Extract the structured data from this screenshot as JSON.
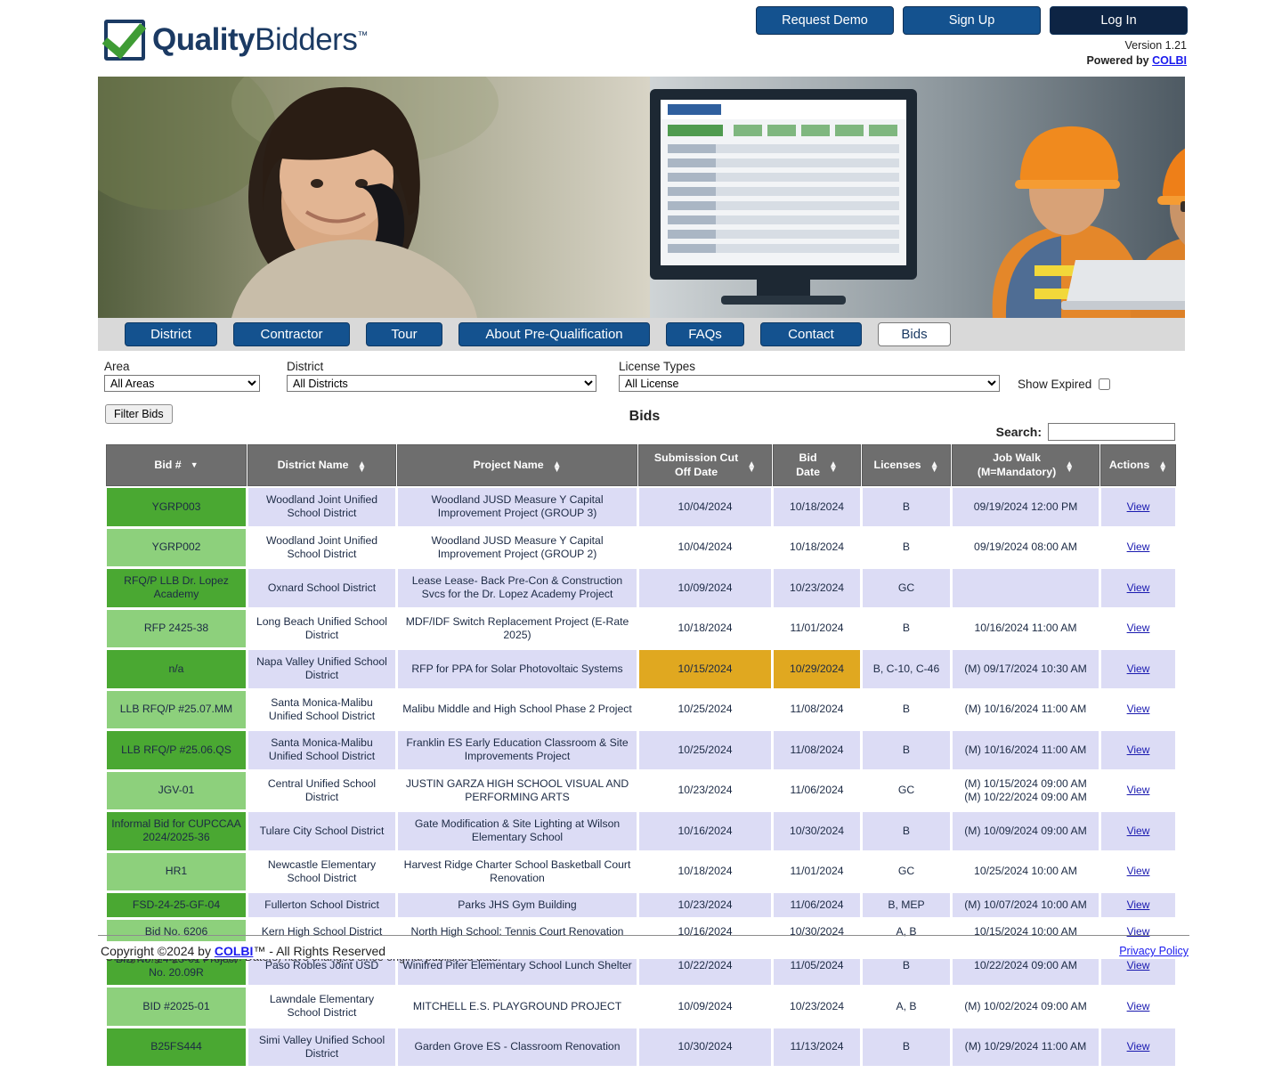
{
  "brand": {
    "name_bold": "Quality",
    "name_light": "Bidders",
    "tm": "™"
  },
  "topbar": {
    "request_demo": "Request Demo",
    "sign_up": "Sign Up",
    "log_in": "Log In",
    "version": "Version 1.21",
    "powered_by": "Powered by ",
    "powered_link": "COLBI"
  },
  "nav": {
    "items": [
      {
        "label": "District",
        "active": false
      },
      {
        "label": "Contractor",
        "active": false
      },
      {
        "label": "Tour",
        "active": false
      },
      {
        "label": "About Pre-Qualification",
        "active": false
      },
      {
        "label": "FAQs",
        "active": false
      },
      {
        "label": "Contact",
        "active": false
      },
      {
        "label": "Bids",
        "active": true
      }
    ]
  },
  "filters": {
    "area_label": "Area",
    "area_value": "All Areas",
    "district_label": "District",
    "district_value": "All Districts",
    "license_label": "License Types",
    "license_value": "All License",
    "show_expired_label": "Show Expired",
    "show_expired_checked": false,
    "filter_button": "Filter Bids"
  },
  "table_section": {
    "title": "Bids",
    "search_label": "Search:",
    "search_value": "",
    "search_placeholder": ""
  },
  "columns": [
    {
      "label": "Bid #",
      "sort": "desc"
    },
    {
      "label": "District Name",
      "sort": "both"
    },
    {
      "label": "Project Name",
      "sort": "both"
    },
    {
      "label": "Submission Cut Off Date",
      "line1": "Submission Cut",
      "line2": "Off Date",
      "sort": "both"
    },
    {
      "label": "Bid Date",
      "line1": "Bid",
      "line2": "Date",
      "sort": "both"
    },
    {
      "label": "Licenses",
      "sort": "both"
    },
    {
      "label": "Job Walk (M=Mandatory)",
      "line1": "Job Walk",
      "line2": "(M=Mandatory)",
      "sort": "both"
    },
    {
      "label": "Actions",
      "sort": "both"
    }
  ],
  "rows": [
    {
      "bid": "YGRP003",
      "district": "Woodland Joint Unified School District",
      "project": "Woodland JUSD Measure Y Capital Improvement Project (GROUP 3)",
      "submission": "10/04/2024",
      "bid_date": "10/18/2024",
      "licenses": "B",
      "job_walk": "09/19/2024 12:00 PM",
      "action": "View",
      "submission_changed": false,
      "bid_date_changed": false
    },
    {
      "bid": "YGRP002",
      "district": "Woodland Joint Unified School District",
      "project": "Woodland JUSD Measure Y Capital Improvement Project (GROUP 2)",
      "submission": "10/04/2024",
      "bid_date": "10/18/2024",
      "licenses": "B",
      "job_walk": "09/19/2024 08:00 AM",
      "action": "View",
      "submission_changed": false,
      "bid_date_changed": false
    },
    {
      "bid": "RFQ/P LLB Dr. Lopez Academy",
      "district": "Oxnard School District",
      "project": "Lease Lease- Back Pre-Con & Construction Svcs for the Dr. Lopez Academy Project",
      "submission": "10/09/2024",
      "bid_date": "10/23/2024",
      "licenses": "GC",
      "job_walk": "",
      "action": "View",
      "submission_changed": false,
      "bid_date_changed": false
    },
    {
      "bid": "RFP 2425-38",
      "district": "Long Beach Unified School District",
      "project": "MDF/IDF Switch Replacement Project (E-Rate 2025)",
      "submission": "10/18/2024",
      "bid_date": "11/01/2024",
      "licenses": "B",
      "job_walk": "10/16/2024 11:00 AM",
      "action": "View",
      "submission_changed": false,
      "bid_date_changed": false
    },
    {
      "bid": "n/a",
      "district": "Napa Valley Unified School District",
      "project": "RFP for PPA for Solar Photovoltaic Systems",
      "submission": "10/15/2024",
      "bid_date": "10/29/2024",
      "licenses": "B, C-10, C-46",
      "job_walk": "(M) 09/17/2024 10:30 AM",
      "action": "View",
      "submission_changed": true,
      "bid_date_changed": true
    },
    {
      "bid": "LLB RFQ/P #25.07.MM",
      "district": "Santa Monica-Malibu Unified School District",
      "project": "Malibu Middle and High School Phase 2 Project",
      "submission": "10/25/2024",
      "bid_date": "11/08/2024",
      "licenses": "B",
      "job_walk": "(M) 10/16/2024 11:00 AM",
      "action": "View",
      "submission_changed": false,
      "bid_date_changed": false
    },
    {
      "bid": "LLB RFQ/P #25.06.QS",
      "district": "Santa Monica-Malibu Unified School District",
      "project": "Franklin ES Early Education Classroom & Site Improvements Project",
      "submission": "10/25/2024",
      "bid_date": "11/08/2024",
      "licenses": "B",
      "job_walk": "(M) 10/16/2024 11:00 AM",
      "action": "View",
      "submission_changed": false,
      "bid_date_changed": false
    },
    {
      "bid": "JGV-01",
      "district": "Central Unified School District",
      "project": "JUSTIN GARZA HIGH SCHOOL VISUAL AND PERFORMING ARTS",
      "submission": "10/23/2024",
      "bid_date": "11/06/2024",
      "licenses": "GC",
      "job_walk": "(M) 10/15/2024 09:00 AM\n(M) 10/22/2024 09:00 AM",
      "action": "View",
      "submission_changed": false,
      "bid_date_changed": false
    },
    {
      "bid": "Informal Bid for CUPCCAA 2024/2025-36",
      "district": "Tulare City School District",
      "project": "Gate Modification & Site Lighting at Wilson Elementary School",
      "submission": "10/16/2024",
      "bid_date": "10/30/2024",
      "licenses": "B",
      "job_walk": "(M) 10/09/2024 09:00 AM",
      "action": "View",
      "submission_changed": false,
      "bid_date_changed": false
    },
    {
      "bid": "HR1",
      "district": "Newcastle Elementary School District",
      "project": "Harvest Ridge Charter School Basketball Court Renovation",
      "submission": "10/18/2024",
      "bid_date": "11/01/2024",
      "licenses": "GC",
      "job_walk": "10/25/2024 10:00 AM",
      "action": "View",
      "submission_changed": false,
      "bid_date_changed": false
    },
    {
      "bid": "FSD-24-25-GF-04",
      "district": "Fullerton School District",
      "project": "Parks JHS Gym Building",
      "submission": "10/23/2024",
      "bid_date": "11/06/2024",
      "licenses": "B, MEP",
      "job_walk": "(M) 10/07/2024 10:00 AM",
      "action": "View",
      "submission_changed": false,
      "bid_date_changed": false
    },
    {
      "bid": "Bid No. 6206",
      "district": "Kern High School District",
      "project": "North High School: Tennis Court Renovation",
      "submission": "10/16/2024",
      "bid_date": "10/30/2024",
      "licenses": "A, B",
      "job_walk": "10/15/2024 10:00 AM",
      "action": "View",
      "submission_changed": false,
      "bid_date_changed": false
    },
    {
      "bid": "BID No. 24-25-01 Project No. 20.09R",
      "district": "Paso Robles Joint USD",
      "project": "Winifred Pifer Elementary School Lunch Shelter",
      "submission": "10/22/2024",
      "bid_date": "11/05/2024",
      "licenses": "B",
      "job_walk": "10/22/2024 09:00 AM",
      "action": "View",
      "submission_changed": false,
      "bid_date_changed": false
    },
    {
      "bid": "BID #2025-01",
      "district": "Lawndale Elementary School District",
      "project": "MITCHELL E.S. PLAYGROUND PROJECT",
      "submission": "10/09/2024",
      "bid_date": "10/23/2024",
      "licenses": "A, B",
      "job_walk": "(M) 10/02/2024 09:00 AM",
      "action": "View",
      "submission_changed": false,
      "bid_date_changed": false
    },
    {
      "bid": "B25FS444",
      "district": "Simi Valley Unified School District",
      "project": "Garden Grove ES - Classroom Renovation",
      "submission": "10/30/2024",
      "bid_date": "11/13/2024",
      "licenses": "B",
      "job_walk": "(M) 10/29/2024 11:00 AM",
      "action": "View",
      "submission_changed": false,
      "bid_date_changed": false
    }
  ],
  "footnote": "Orange highlighted Date(s): Date(s) have changed since original published date.",
  "footer": {
    "copyright_pre": "Copyright ©2024 by ",
    "copyright_link": "COLBI",
    "copyright_post": "™ - All Rights Reserved",
    "privacy": "Privacy Policy"
  },
  "colors": {
    "brand_navy": "#1b3a63",
    "brand_blue": "#14528f",
    "brand_green": "#3f9c35",
    "row_lavender": "#dcdcf5",
    "bid_green_dark": "#4aa832",
    "bid_green_light": "#8dd07c",
    "changed_orange": "#e0a820",
    "header_gray": "#6e6e6e"
  }
}
